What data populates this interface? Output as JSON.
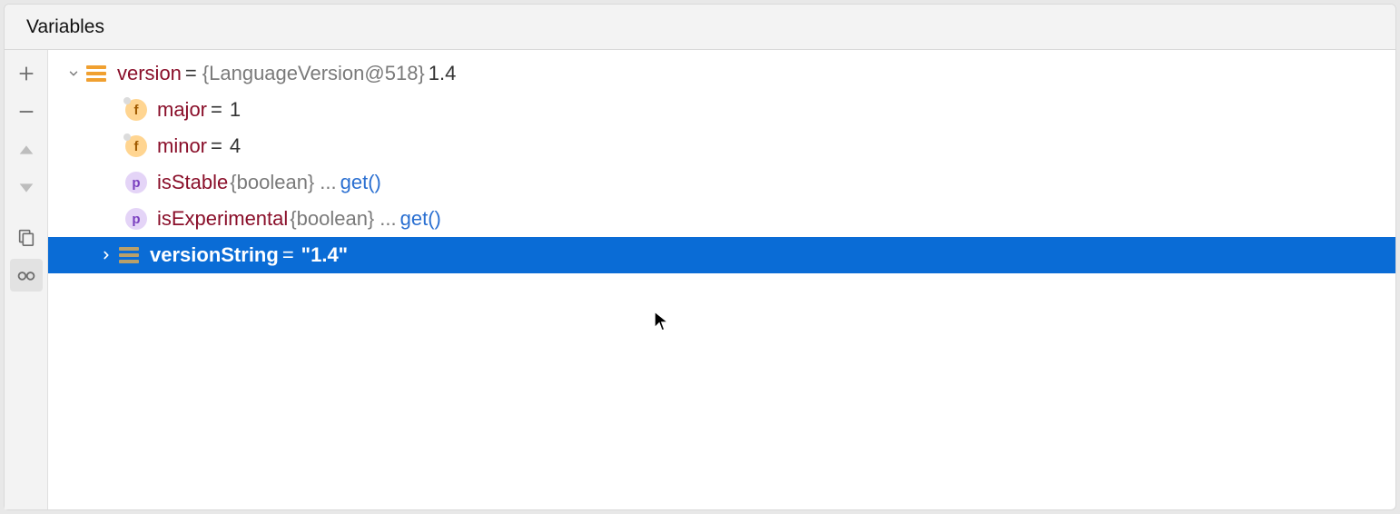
{
  "header": {
    "title": "Variables"
  },
  "toolbar": {
    "add_title": "New Watch",
    "remove_title": "Remove Watch",
    "up_title": "Move Up",
    "down_title": "Move Down",
    "copy_title": "Duplicate",
    "view_title": "Show watches"
  },
  "tree": {
    "root": {
      "name": "version",
      "eq": " = ",
      "typeinfo": "{LanguageVersion@518} ",
      "value": "1.4"
    },
    "children": [
      {
        "kind": "field",
        "icon_letter": "f",
        "name": "major",
        "eq": " = ",
        "value": "1"
      },
      {
        "kind": "field",
        "icon_letter": "f",
        "name": "minor",
        "eq": " = ",
        "value": "4"
      },
      {
        "kind": "prop",
        "icon_letter": "p",
        "name": "isStable",
        "typeinfo": " {boolean}",
        "dots": "  ...",
        "get": " get()"
      },
      {
        "kind": "prop",
        "icon_letter": "p",
        "name": "isExperimental",
        "typeinfo": " {boolean}",
        "dots": "  ...",
        "get": " get()"
      },
      {
        "kind": "obj",
        "name": "versionString",
        "eq": " = ",
        "value": "\"1.4\"",
        "selected": true,
        "expandable": true
      }
    ]
  }
}
